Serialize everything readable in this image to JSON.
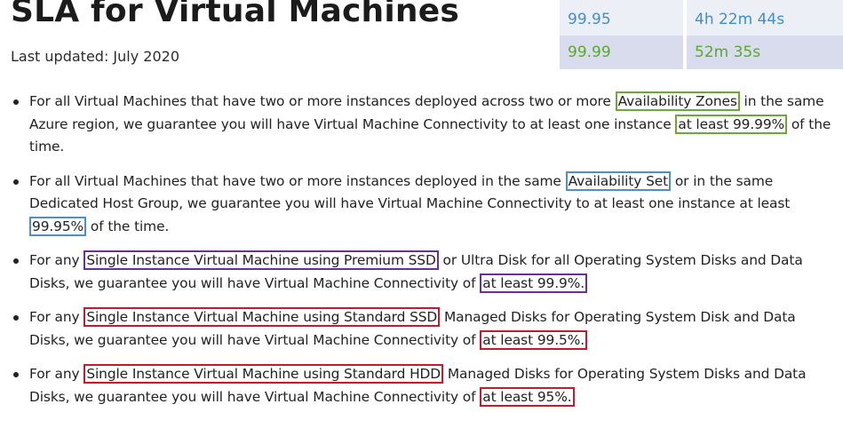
{
  "page": {
    "title": "SLA for Virtual Machines",
    "updated": "Last updated: July 2020"
  },
  "table": {
    "rows": [
      {
        "sla": "99.95",
        "downtime": "4h 22m 44s",
        "color": "#3d8fd0"
      },
      {
        "sla": "99.99",
        "downtime": "52m 35s",
        "color": "#5aa832"
      }
    ]
  },
  "highlight_colors": {
    "green": "#6aa936",
    "blue": "#4f8ec9",
    "purple": "#6a2f9a",
    "red": "#c6192c"
  },
  "bullets": [
    {
      "t1": "For all Virtual Machines that have two or more instances deployed across two or more ",
      "h1": "Availability Zones",
      "t2": " in the same Azure region, we guarantee you will have Virtual Machine Connectivity to at least one instance ",
      "h2": "at least 99.99%",
      "t3": " of the time."
    },
    {
      "t1": "For all Virtual Machines that have two or more instances deployed in the same ",
      "h1": "Availability Set",
      "t2": " or in the same Dedicated Host Group, we guarantee you will have Virtual Machine Connectivity to at least one instance at least ",
      "h2": "99.95%",
      "t3": " of the time."
    },
    {
      "t1": "For any ",
      "h1": "Single Instance Virtual Machine using Premium SSD",
      "t2": " or Ultra Disk for all Operating System Disks and Data Disks, we guarantee you will have Virtual Machine Connectivity of ",
      "h2": "at least 99.9%."
    },
    {
      "t1": "For any ",
      "h1": "Single Instance Virtual Machine using Standard SSD",
      "t2": " Managed Disks for Operating System Disk and Data Disks, we guarantee you will have Virtual Machine Connectivity of ",
      "h2": "at least 99.5%."
    },
    {
      "t1": "For any ",
      "h1": "Single Instance Virtual Machine using Standard HDD",
      "t2": " Managed Disks for Operating System Disks and Data Disks, we guarantee you will have Virtual Machine Connectivity of ",
      "h2": "at least 95%."
    }
  ]
}
